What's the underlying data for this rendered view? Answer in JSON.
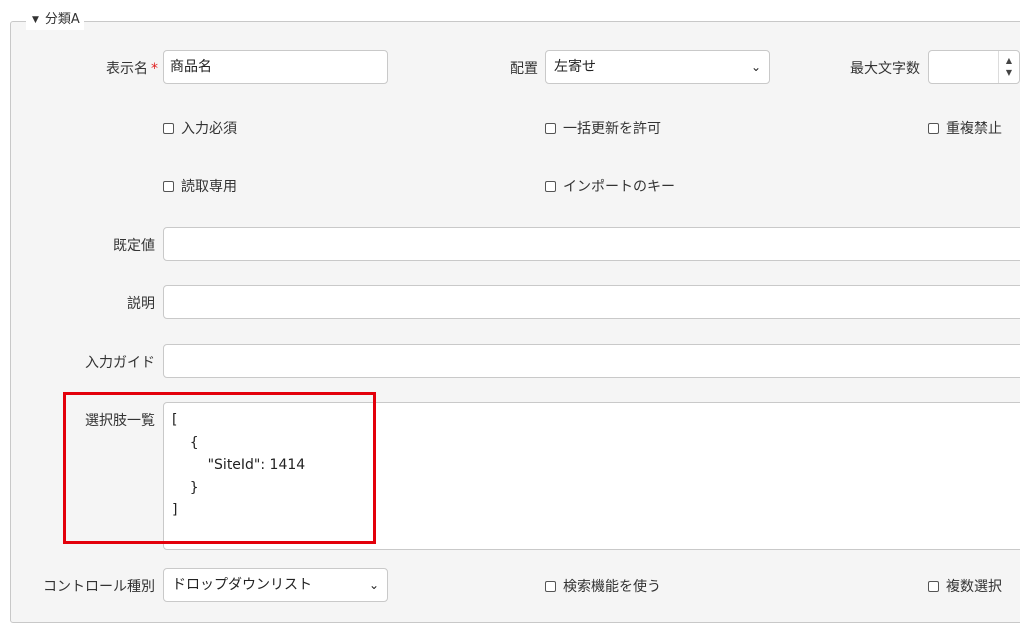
{
  "section": {
    "title": "分類A"
  },
  "fields": {
    "display_name": {
      "label": "表示名",
      "required_mark": "*",
      "value": "商品名"
    },
    "alignment": {
      "label": "配置",
      "value": "左寄せ"
    },
    "max_length": {
      "label": "最大文字数",
      "value": ""
    },
    "default_value": {
      "label": "既定値",
      "value": ""
    },
    "description": {
      "label": "説明",
      "value": ""
    },
    "input_guide": {
      "label": "入力ガイド",
      "value": ""
    },
    "choices": {
      "label": "選択肢一覧",
      "value": "[\n    {\n        \"SiteId\": 1414\n    }\n]"
    },
    "control_type": {
      "label": "コントロール種別",
      "value": "ドロップダウンリスト"
    }
  },
  "checkboxes": {
    "required": {
      "label": "入力必須",
      "checked": false
    },
    "bulk_update": {
      "label": "一括更新を許可",
      "checked": false
    },
    "no_duplicates": {
      "label": "重複禁止",
      "checked": false
    },
    "read_only": {
      "label": "読取専用",
      "checked": false
    },
    "import_key": {
      "label": "インポートのキー",
      "checked": false
    },
    "use_search": {
      "label": "検索機能を使う",
      "checked": false
    },
    "multiple_select": {
      "label": "複数選択",
      "checked": false
    }
  },
  "icons": {
    "collapse": "caret-down-icon",
    "select": "chevron-down-icon",
    "spinner": "spinner-arrows-icon"
  },
  "colors": {
    "highlight": "#e3000b",
    "required": "#e02020",
    "panel_bg": "#f5f5f5"
  }
}
